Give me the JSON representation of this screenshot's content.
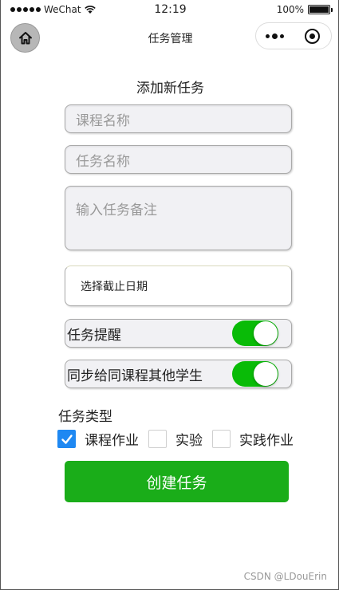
{
  "status_bar": {
    "carrier": "WeChat",
    "time": "12:19",
    "battery": "100%"
  },
  "nav": {
    "title": "任务管理",
    "home_icon": "home-icon",
    "more_icon": "more-dots-icon",
    "close_icon": "target-close-icon"
  },
  "form": {
    "title": "添加新任务",
    "course_placeholder": "课程名称",
    "task_placeholder": "任务名称",
    "note_placeholder": "输入任务备注",
    "date_label": "选择截止日期",
    "reminder_label": "任务提醒",
    "reminder_on": true,
    "sync_label": "同步给同课程其他学生",
    "sync_on": true,
    "type_title": "任务类型",
    "types": [
      {
        "label": "课程作业",
        "checked": true
      },
      {
        "label": "实验",
        "checked": false
      },
      {
        "label": "实践作业",
        "checked": false
      }
    ],
    "submit_label": "创建任务"
  },
  "watermark": "CSDN @LDouErin",
  "colors": {
    "primary_green": "#1aad19",
    "switch_green": "#09bb07",
    "check_blue": "#1e88f2"
  }
}
